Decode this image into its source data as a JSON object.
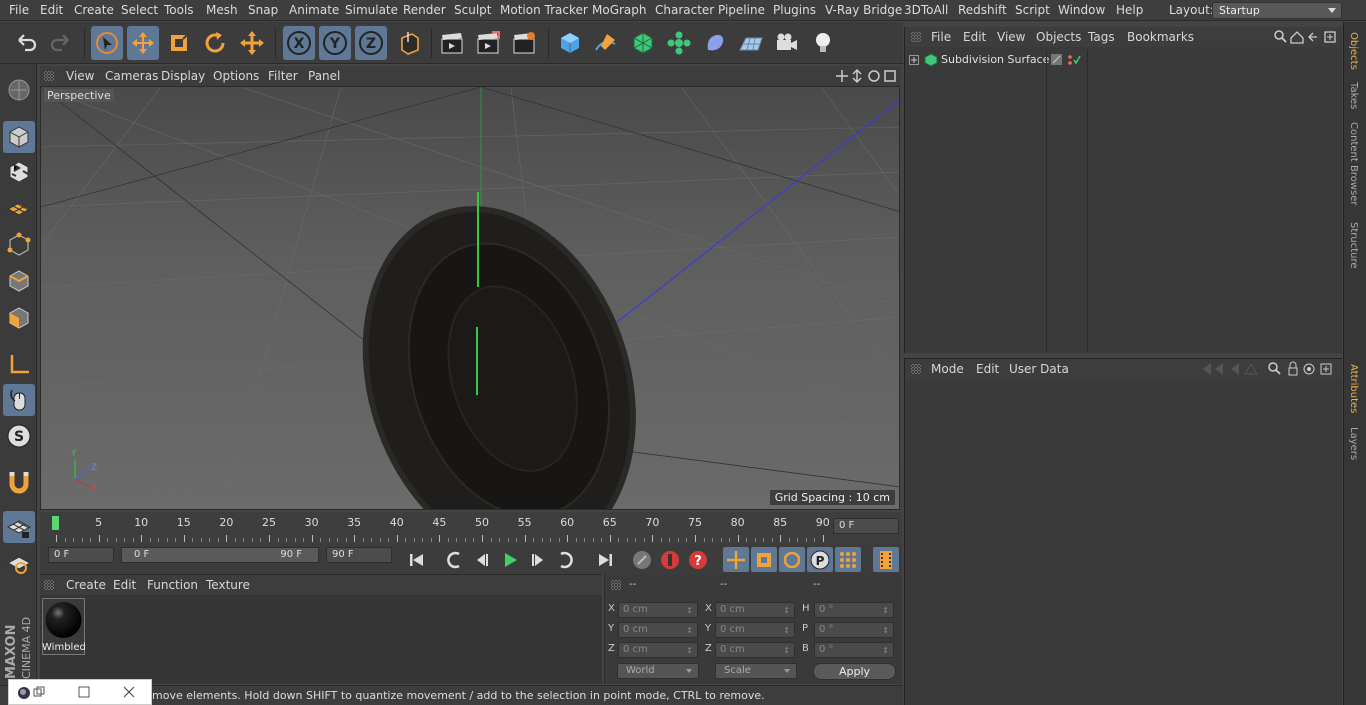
{
  "menubar": {
    "items": [
      "File",
      "Edit",
      "Create",
      "Select",
      "Tools",
      "Mesh",
      "Snap",
      "Animate",
      "Simulate",
      "Render",
      "Sculpt",
      "Motion Tracker",
      "MoGraph",
      "Character",
      "Pipeline",
      "Plugins",
      "V-Ray Bridge",
      "3DToAll",
      "Redshift",
      "Script",
      "Window",
      "Help"
    ],
    "layout_label": "Layout:",
    "layout_value": "Startup"
  },
  "viewport": {
    "menu": [
      "View",
      "Cameras",
      "Display",
      "Options",
      "Filter",
      "Panel"
    ],
    "camera_label": "Perspective",
    "grid_spacing": "Grid Spacing : 10 cm",
    "axis_labels": {
      "y": "Y",
      "z": "Z",
      "x": "X"
    }
  },
  "timeline": {
    "ticks": [
      "0",
      "5",
      "10",
      "15",
      "20",
      "25",
      "30",
      "35",
      "40",
      "45",
      "50",
      "55",
      "60",
      "65",
      "70",
      "75",
      "80",
      "85",
      "90"
    ],
    "current_frame": "0 F",
    "start_field": "0 F",
    "range_start": "0 F",
    "range_end": "90 F",
    "end_field": "90 F"
  },
  "material": {
    "menu": [
      "Create",
      "Edit",
      "Function",
      "Texture"
    ],
    "name": "Wimbled"
  },
  "coords": {
    "headers": [
      "--",
      "--",
      "--"
    ],
    "rows": [
      {
        "l1": "X",
        "v1": "0 cm",
        "l2": "X",
        "v2": "0 cm",
        "l3": "H",
        "v3": "0 °"
      },
      {
        "l1": "Y",
        "v1": "0 cm",
        "l2": "Y",
        "v2": "0 cm",
        "l3": "P",
        "v3": "0 °"
      },
      {
        "l1": "Z",
        "v1": "0 cm",
        "l2": "Z",
        "v2": "0 cm",
        "l3": "B",
        "v3": "0 °"
      }
    ],
    "space": "World",
    "mode": "Scale",
    "apply": "Apply"
  },
  "status": {
    "text": "move elements. Hold down SHIFT to quantize movement / add to the selection in point mode, CTRL to remove."
  },
  "objects": {
    "menu": [
      "File",
      "Edit",
      "View",
      "Objects",
      "Tags",
      "Bookmarks"
    ],
    "items": [
      {
        "name": "Subdivision Surface"
      }
    ]
  },
  "attributes": {
    "menu": [
      "Mode",
      "Edit",
      "User Data"
    ]
  },
  "side_tabs": [
    "Objects",
    "Takes",
    "Content Browser",
    "Structure",
    "Attributes",
    "Layers"
  ],
  "colors": {
    "accent": "#5f7896",
    "playhead": "#59d86e",
    "y_axis": "#2ecc40",
    "z_axis": "#3344ee",
    "x_axis": "#cc3333"
  }
}
